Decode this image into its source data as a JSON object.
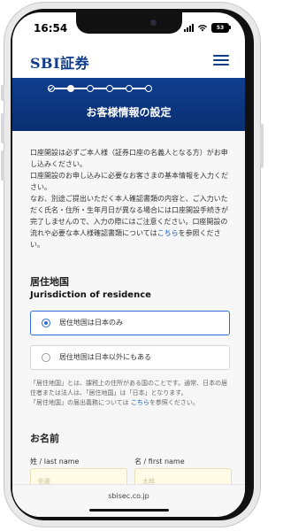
{
  "status_bar": {
    "time": "16:54",
    "battery": "53"
  },
  "header": {
    "logo": "SBI証券"
  },
  "banner": {
    "title": "お客様情報の設定"
  },
  "intro": {
    "p1": "口座開設は必ずご本人様（証券口座の名義人となる方）がお申し込みください。",
    "p2": "口座開設のお申し込みに必要なお客さまの基本情報を入力ください。",
    "p3a": "なお、別途ご提出いただく本人確認書類の内容と、ご入力いただく氏名・住所・生年月日が異なる場合には口座開設手続きが完了しませんので、入力の際にはご注意ください。口座開設の流れや必要な本人様確認書類については",
    "link1": "こちら",
    "p3b": "を参照ください。"
  },
  "residence": {
    "title": "居住地国",
    "subtitle": "Jurisdiction of residence",
    "option_japan": "居住地国は日本のみ",
    "option_other": "居住地国は日本以外にもある",
    "note1": "「居住地国」とは、課税上の住所がある国のことです。通常、日本の居住者または法人は、「居住地国」は「日本」となります。",
    "note2a": "「居住地国」の届出義務については ",
    "note2_link": "こちら",
    "note2b": "を参照ください。"
  },
  "name": {
    "title": "お名前",
    "last_label": "姓 / last name",
    "first_label": "名 / first name",
    "last_placeholder": "佐藤",
    "first_placeholder": "太郎"
  },
  "browser": {
    "url": "sbisec.co.jp"
  },
  "progress": {
    "total_steps": 6,
    "current_step": 2
  }
}
